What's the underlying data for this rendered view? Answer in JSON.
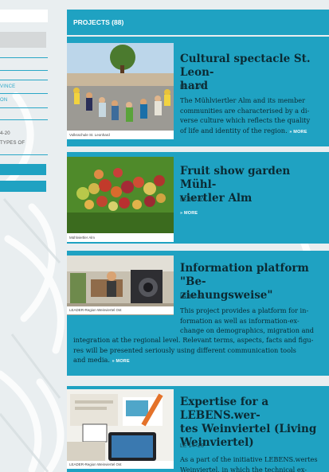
{
  "sidebar": {
    "items": [
      "VINCE",
      "ON",
      "4-20",
      "TYPES OF"
    ]
  },
  "header": {
    "title": "PROJECTS (88)"
  },
  "projects": [
    {
      "title": "Cultural spectacle St. Leonhard",
      "title_lines": [
        "Cultural spectacle St. Leon-",
        "hard"
      ],
      "tag": "LE 14–20",
      "description_lines": [
        "The Mühlviertler Alm and its member",
        "communities are characterised by a di-",
        "verse culture which reflects the quality",
        "of life and identity of the region."
      ],
      "more": "» MORE",
      "caption": "Volksschule St. Leonhard"
    },
    {
      "title": "Fruit show garden Mühlviertler Alm",
      "title_lines": [
        "Fruit show garden Mühl-",
        "viertler Alm"
      ],
      "tag": "LE 14–20",
      "more": "» MORE",
      "caption": "Mühlviertler Alm"
    },
    {
      "title": "Information platform \"Beziehungsweise\"",
      "title_lines": [
        "Information platform \"Be-",
        "ziehungsweise\""
      ],
      "tag": "LE 14–20",
      "description_lines": [
        "This project provides a platform for in-",
        "formation as well as information-ex-",
        "change on demographics, migration and",
        "integration at the regional level. Relevant terms, aspects, facts and figu-",
        "res will be presented seriously using different communication tools",
        "and media."
      ],
      "more": "» MORE",
      "caption": "LEADER-Region Weinviertel Ost"
    },
    {
      "title": "Expertise for a LEBENS.wertes Weinviertel (Living Weinviertel)",
      "title_lines": [
        "Expertise for a LEBENS.wer-",
        "tes Weinviertel (Living",
        "Weinviertel)"
      ],
      "tag": "LE 14–20",
      "description_lines": [
        "As a part of the initiative LEBENS.wertes",
        "Weinviertel, in which the technical ex-"
      ],
      "caption": "LEADER-Region Weinviertel Ost"
    }
  ]
}
